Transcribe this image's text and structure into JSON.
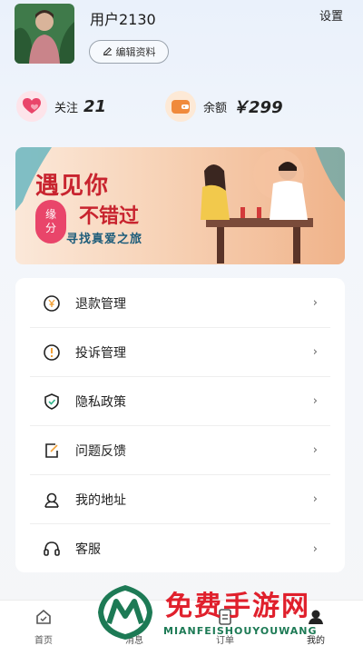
{
  "profile": {
    "username": "用户2130",
    "edit_label": "编辑资料",
    "settings_label": "设置"
  },
  "stats": {
    "follow_label": "关注",
    "follow_count": "21",
    "balance_label": "余额",
    "balance_value": "￥299"
  },
  "banner": {
    "line1": "遇见你",
    "line2": "不错过",
    "badge_top": "缘",
    "badge_bottom": "分",
    "slogan": "寻找真爱之旅"
  },
  "menu": {
    "items": [
      {
        "label": "退款管理",
        "icon": "refund-icon"
      },
      {
        "label": "投诉管理",
        "icon": "complaint-icon"
      },
      {
        "label": "隐私政策",
        "icon": "shield-icon"
      },
      {
        "label": "问题反馈",
        "icon": "feedback-icon"
      },
      {
        "label": "我的地址",
        "icon": "address-icon"
      },
      {
        "label": "客服",
        "icon": "headset-icon"
      }
    ],
    "chevron": "›"
  },
  "tabbar": {
    "home": "首页",
    "messages": "消息",
    "orders": "订单",
    "mine": "我的"
  },
  "watermark": {
    "title": "免费手游网",
    "subtitle": "MIANFEISHOUYOUWANG"
  },
  "colors": {
    "accent_pink": "#e9456a",
    "accent_orange": "#f08a3c",
    "watermark_red": "#e0202c",
    "watermark_green": "#1d7a55"
  }
}
